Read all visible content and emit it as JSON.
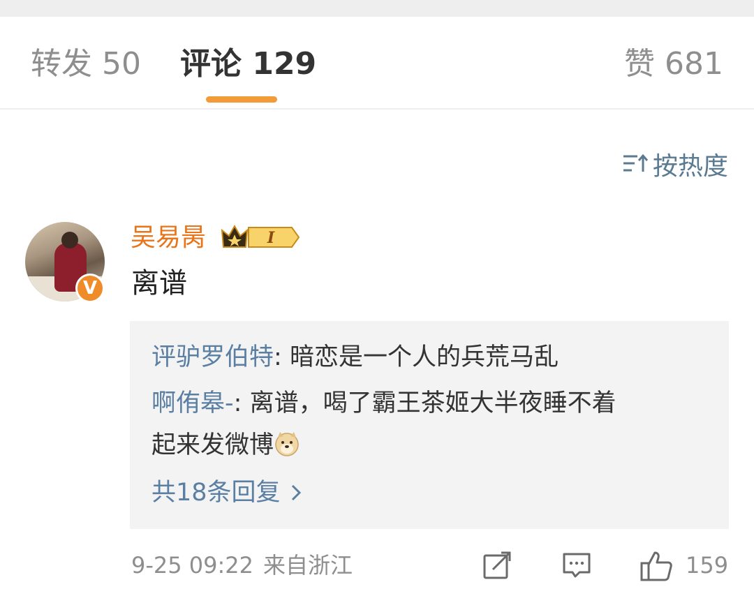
{
  "tabs": {
    "repost": {
      "label": "转发",
      "count": "50"
    },
    "comments": {
      "label": "评论",
      "count": "129"
    },
    "likes": {
      "label": "赞",
      "count": "681"
    }
  },
  "sort": {
    "label": "按热度",
    "icon": "sort-icon"
  },
  "comment": {
    "username": "吴易昺",
    "vip_level": "I",
    "verified_badge": "V",
    "text": "离谱",
    "replies": [
      {
        "user": "评驴罗伯特",
        "separator": ": ",
        "text": "暗恋是一个人的兵荒马乱"
      },
      {
        "user": "啊侑皋-",
        "separator": ": ",
        "text": "离谱，喝了霸王茶姬大半夜睡不着",
        "text_line2": "起来发微博",
        "emoji": "doge-emoji"
      }
    ],
    "reply_count_label": "共18条回复",
    "date": "9-25 09:22",
    "location": "来自浙江",
    "like_count": "159"
  },
  "colors": {
    "accent": "#f29b38",
    "username": "#e8751a",
    "link": "#5a7fa3",
    "muted": "#8e8e8e"
  }
}
